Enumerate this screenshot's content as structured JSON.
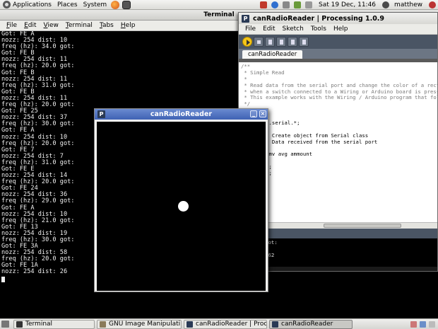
{
  "top_panel": {
    "menus": [
      "Applications",
      "Places",
      "System"
    ],
    "clock": "Sat 19 Dec, 11:46",
    "user": "matthew"
  },
  "terminal": {
    "title": "Terminal",
    "menus": [
      {
        "u": "F",
        "rest": "ile"
      },
      {
        "u": "E",
        "rest": "dit"
      },
      {
        "u": "V",
        "rest": "iew"
      },
      {
        "u": "T",
        "rest": "erminal"
      },
      {
        "u": "T",
        "rest": "abs"
      },
      {
        "u": "H",
        "rest": "elp"
      }
    ],
    "lines": [
      "Got: FE A",
      "nozz: 254 dist: 10",
      "freq (hz): 34.0 got:",
      "Got: FE B",
      "nozz: 254 dist: 11",
      "freq (hz): 20.0 got:",
      "Got: FE B",
      "nozz: 254 dist: 11",
      "freq (hz): 31.0 got:",
      "Got: FE B",
      "nozz: 254 dist: 11",
      "freq (hz): 20.0 got:",
      "Got: FE 25",
      "nozz: 254 dist: 37",
      "freq (hz): 30.0 got:",
      "Got: FE A",
      "nozz: 254 dist: 10",
      "freq (hz): 20.0 got:",
      "Got: FE 7",
      "nozz: 254 dist: 7",
      "freq (hz): 31.0 got:",
      "Got: FE E",
      "nozz: 254 dist: 14",
      "freq (hz): 20.0 got:",
      "Got: FE 24",
      "nozz: 254 dist: 36",
      "freq (hz): 29.0 got:",
      "Got: FE A",
      "nozz: 254 dist: 10",
      "freq (hz): 21.0 got:",
      "Got: FE 13",
      "nozz: 254 dist: 19",
      "freq (hz): 30.0 got:",
      "Got: FE 3A",
      "nozz: 254 dist: 58",
      "freq (hz): 20.0 got:",
      "Got: FE 1A",
      "nozz: 254 dist: 26"
    ]
  },
  "processing": {
    "title": "canRadioReader | Processing 1.0.9",
    "menus": [
      "File",
      "Edit",
      "Sketch",
      "Tools",
      "Help"
    ],
    "tab": "canRadioReader",
    "code": [
      "/**",
      " * Simple Read",
      " *",
      " * Read data from the serial port and change the color of a recta",
      " * when a switch connected to a Wiring or Arduino board is presse",
      " * This example works with the Wiring / Arduino program that foll",
      " */",
      "",
      "",
      "rocessing.serial.*;",
      "",
      "Port;  // Create object from Serial class",
      "       // Data received from the serial port",
      "",
      "N = 5; //mv avg ammount",
      "",
      " nozzHist;",
      " distHist;",
      "",
      "",
      "p()",
      "",
      "0, 400);"
    ],
    "console": [
      "): 20.0 got:",
      "",
      "  dist: 162",
      "",
      ""
    ]
  },
  "sketch": {
    "title": "canRadioReader"
  },
  "taskbar": {
    "items": [
      "Terminal",
      "GNU Image Manipulati...",
      "canRadioReader | Proc...",
      "canRadioReader"
    ]
  }
}
